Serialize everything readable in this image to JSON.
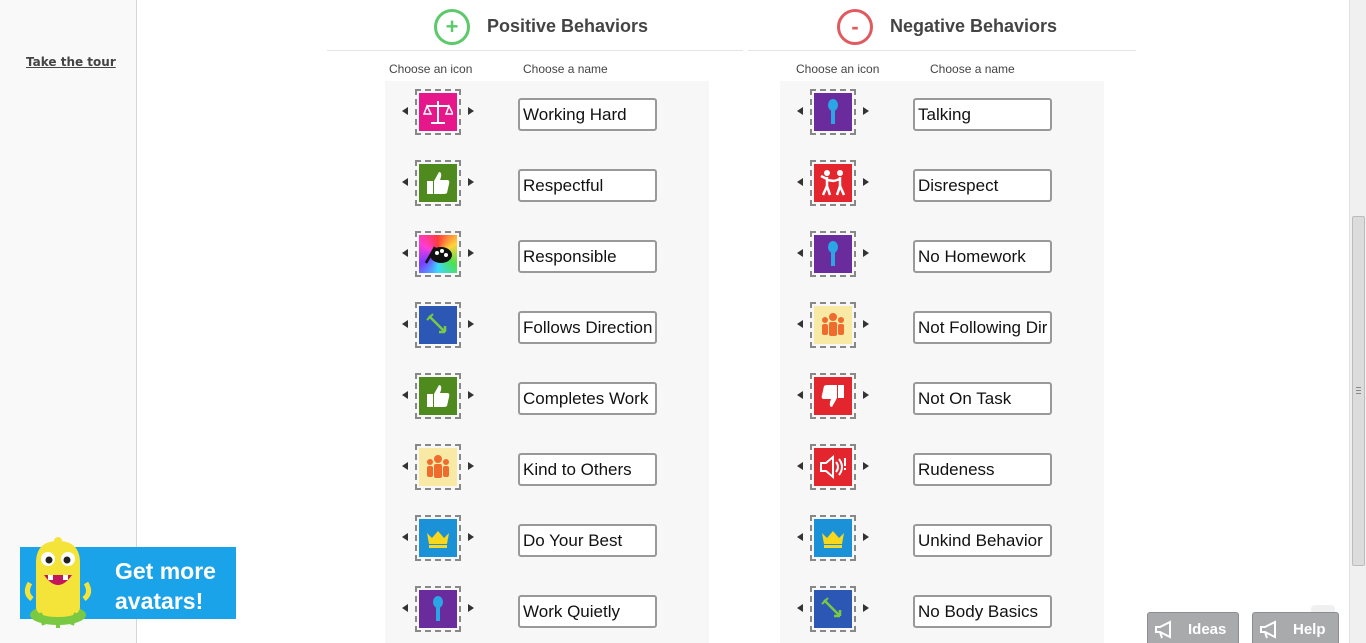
{
  "sidebar": {
    "tour_label": "Take the tour"
  },
  "promo": {
    "line1": "Get more",
    "line2": "avatars!"
  },
  "positive": {
    "symbol": "+",
    "title": "Positive Behaviors",
    "icon_label": "Choose an icon",
    "name_label": "Choose a name",
    "rows": [
      {
        "icon": "scales-icon",
        "bg": "#e5178a",
        "name": "Working Hard"
      },
      {
        "icon": "thumbs-up-icon",
        "bg": "#4e8a1d",
        "name": "Respectful"
      },
      {
        "icon": "palette-icon",
        "bg": "rainbow",
        "name": "Responsible"
      },
      {
        "icon": "arrow-target-icon",
        "bg": "#2c57b4",
        "name": "Follows Directions"
      },
      {
        "icon": "thumbs-up-icon",
        "bg": "#4e8a1d",
        "name": "Completes Work"
      },
      {
        "icon": "people-icon",
        "bg": "#f8e9a4",
        "name": "Kind to Others"
      },
      {
        "icon": "crown-icon",
        "bg": "#1b91d8",
        "name": "Do Your Best"
      },
      {
        "icon": "microphone-icon",
        "bg": "#6a2c9c",
        "name": "Work Quietly"
      }
    ]
  },
  "negative": {
    "symbol": "-",
    "title": "Negative Behaviors",
    "icon_label": "Choose an icon",
    "name_label": "Choose a name",
    "rows": [
      {
        "icon": "microphone-icon",
        "bg": "#6a2c9c",
        "name": "Talking"
      },
      {
        "icon": "fighting-people-icon",
        "bg": "#e3262d",
        "name": "Disrespect"
      },
      {
        "icon": "microphone-icon",
        "bg": "#6a2c9c",
        "name": "No Homework"
      },
      {
        "icon": "people-icon",
        "bg": "#f8e9a4",
        "name": "Not Following Directions"
      },
      {
        "icon": "thumbs-down-icon",
        "bg": "#e3262d",
        "name": "Not On Task"
      },
      {
        "icon": "loud-speaker-icon",
        "bg": "#e3262d",
        "name": "Rudeness"
      },
      {
        "icon": "crown-icon",
        "bg": "#1b91d8",
        "name": "Unkind Behavior"
      },
      {
        "icon": "arrow-target-icon",
        "bg": "#2c57b4",
        "name": "No Body Basics"
      }
    ]
  },
  "buttons": {
    "ideas": "Ideas",
    "help": "Help"
  },
  "colors": {
    "positive_accent": "#5cc96a",
    "negative_accent": "#e05a5f",
    "promo_bg": "#1aa3e8"
  }
}
